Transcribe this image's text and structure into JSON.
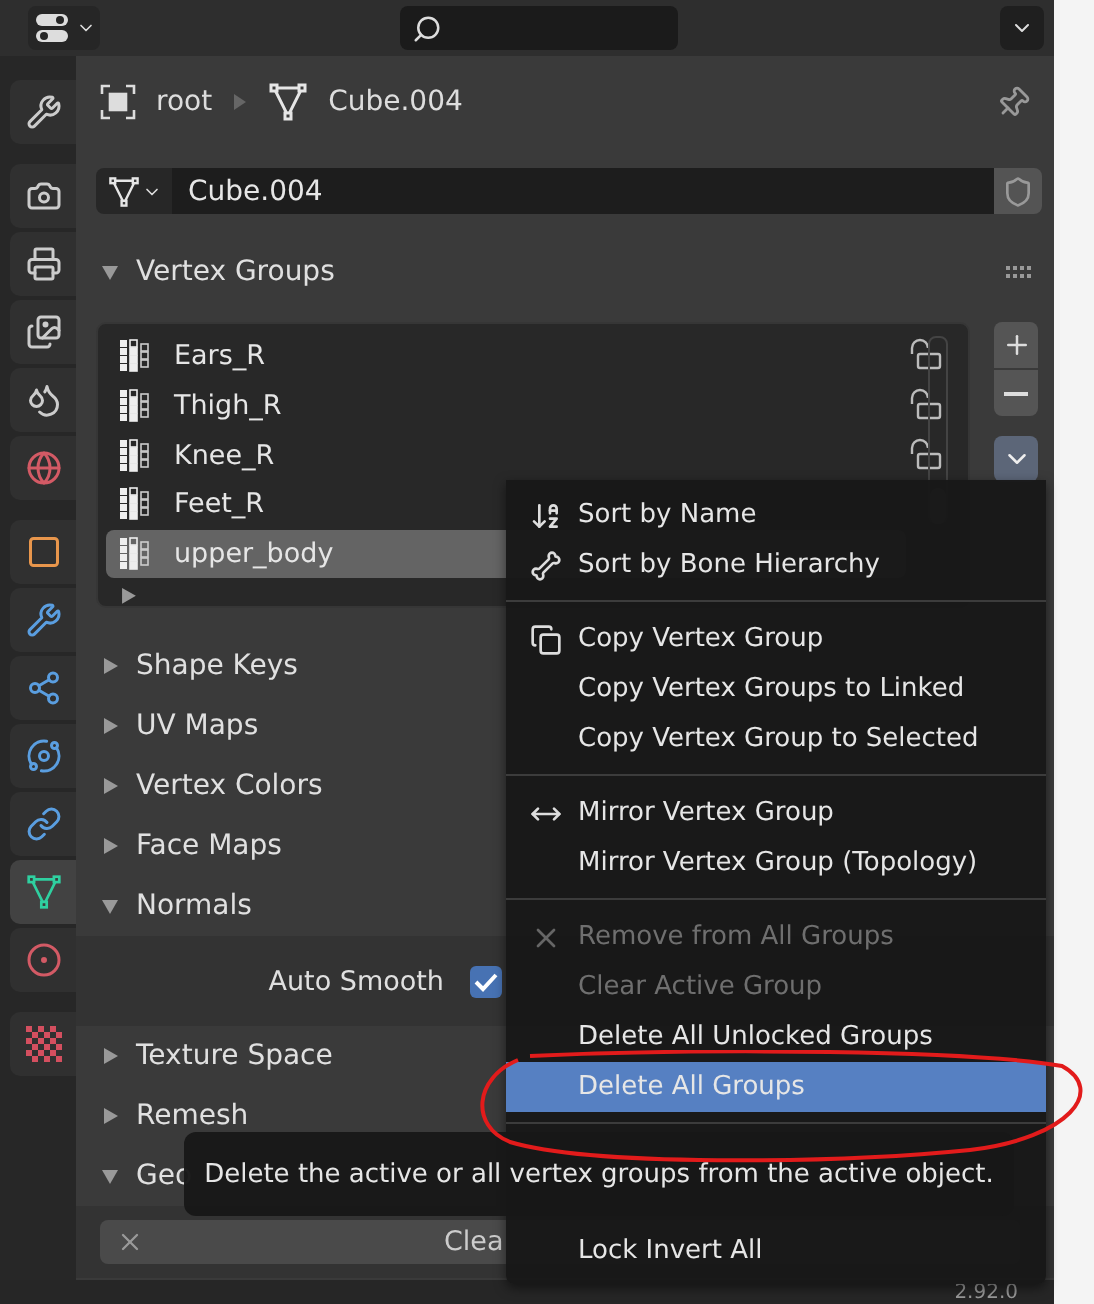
{
  "tabs": [
    {
      "selected": false
    },
    {
      "selected": false
    },
    {
      "selected": false
    },
    {
      "selected": false
    },
    {
      "selected": false
    },
    {
      "selected": false
    },
    {
      "selected": false
    },
    {
      "selected": false
    },
    {
      "selected": false
    },
    {
      "selected": false
    },
    {
      "selected": false
    },
    {
      "selected": true
    },
    {
      "selected": false
    },
    {
      "selected": false
    }
  ],
  "breadcrumb": {
    "items": [
      "root",
      "Cube.004"
    ]
  },
  "mesh_field": {
    "value": "Cube.004"
  },
  "vertex_groups": {
    "title": "Vertex Groups",
    "expanded": true,
    "items": [
      {
        "name": "Ears_R",
        "selected": false,
        "locked": false
      },
      {
        "name": "Thigh_R",
        "selected": false,
        "locked": false
      },
      {
        "name": "Knee_R",
        "selected": false,
        "locked": false
      },
      {
        "name": "Feet_R",
        "selected": false
      },
      {
        "name": "upper_body",
        "selected": true
      }
    ]
  },
  "sections": [
    {
      "label": "Shape Keys",
      "expanded": false
    },
    {
      "label": "UV Maps",
      "expanded": false
    },
    {
      "label": "Vertex Colors",
      "expanded": false
    },
    {
      "label": "Face Maps",
      "expanded": false
    },
    {
      "label": "Normals",
      "expanded": true,
      "checkbox": {
        "label": "Auto Smooth",
        "checked": true
      }
    },
    {
      "label": "Texture Space",
      "expanded": false
    },
    {
      "label": "Remesh",
      "expanded": false
    },
    {
      "label": "Geo",
      "expanded": true,
      "button": "Clea"
    }
  ],
  "context_menu": {
    "groups": [
      [
        {
          "label": "Sort by Name",
          "disabled": false,
          "selected": false
        },
        {
          "label": "Sort by Bone Hierarchy",
          "disabled": false,
          "selected": false
        }
      ],
      [
        {
          "label": "Copy Vertex Group",
          "disabled": false,
          "selected": false
        },
        {
          "label": "Copy Vertex Groups to Linked",
          "disabled": false,
          "selected": false
        },
        {
          "label": "Copy Vertex Group to Selected",
          "disabled": false,
          "selected": false
        }
      ],
      [
        {
          "label": "Mirror Vertex Group",
          "disabled": false,
          "selected": false
        },
        {
          "label": "Mirror Vertex Group (Topology)",
          "disabled": false,
          "selected": false
        }
      ],
      [
        {
          "label": "Remove from All Groups",
          "disabled": true,
          "selected": false
        },
        {
          "label": "Clear Active Group",
          "disabled": true,
          "selected": false
        },
        {
          "label": "Delete All Unlocked Groups",
          "disabled": false,
          "selected": false
        },
        {
          "label": "Delete All Groups",
          "disabled": false,
          "selected": true
        }
      ],
      [
        {
          "label": "Lock Invert All",
          "disabled": false,
          "selected": false
        }
      ]
    ]
  },
  "tooltip": "Delete the active or all vertex groups from the active object.",
  "status_bar": {
    "version": "2.92.0"
  }
}
